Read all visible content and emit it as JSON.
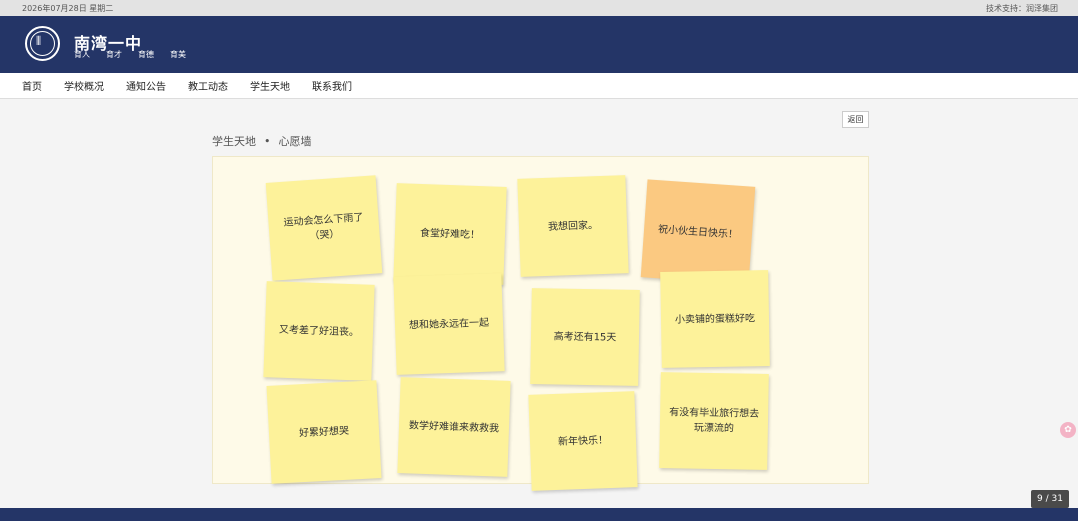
{
  "topbar": {
    "date": "2026年07月28日 星期二",
    "support": "技术支持：润泽集团"
  },
  "header": {
    "school_name": "南湾一中",
    "mottos": [
      "育人",
      "育才",
      "育德",
      "育美"
    ]
  },
  "nav": {
    "items": [
      "首页",
      "学校概况",
      "通知公告",
      "教工动态",
      "学生天地",
      "联系我们"
    ]
  },
  "back_label": "返回",
  "breadcrumb": {
    "section": "学生天地",
    "separator": "•",
    "page": "心愿墙"
  },
  "notes": [
    "运动会怎么下雨了（哭）",
    "食堂好难吃！",
    "我想回家。",
    "祝小伙生日快乐！",
    "又考差了好沮丧。",
    "想和她永远在一起",
    "高考还有15天",
    "小卖铺的蛋糕好吃",
    "好累好想哭",
    "数学好难谁来救救我",
    "新年快乐！",
    "有没有毕业旅行想去玩漂流的"
  ],
  "colors": {
    "header_bg": "#243567",
    "note_yellow": "#fdf29a",
    "note_orange": "#fbc981"
  },
  "side_icon": "flower-icon",
  "page_indicator": "9 / 31"
}
